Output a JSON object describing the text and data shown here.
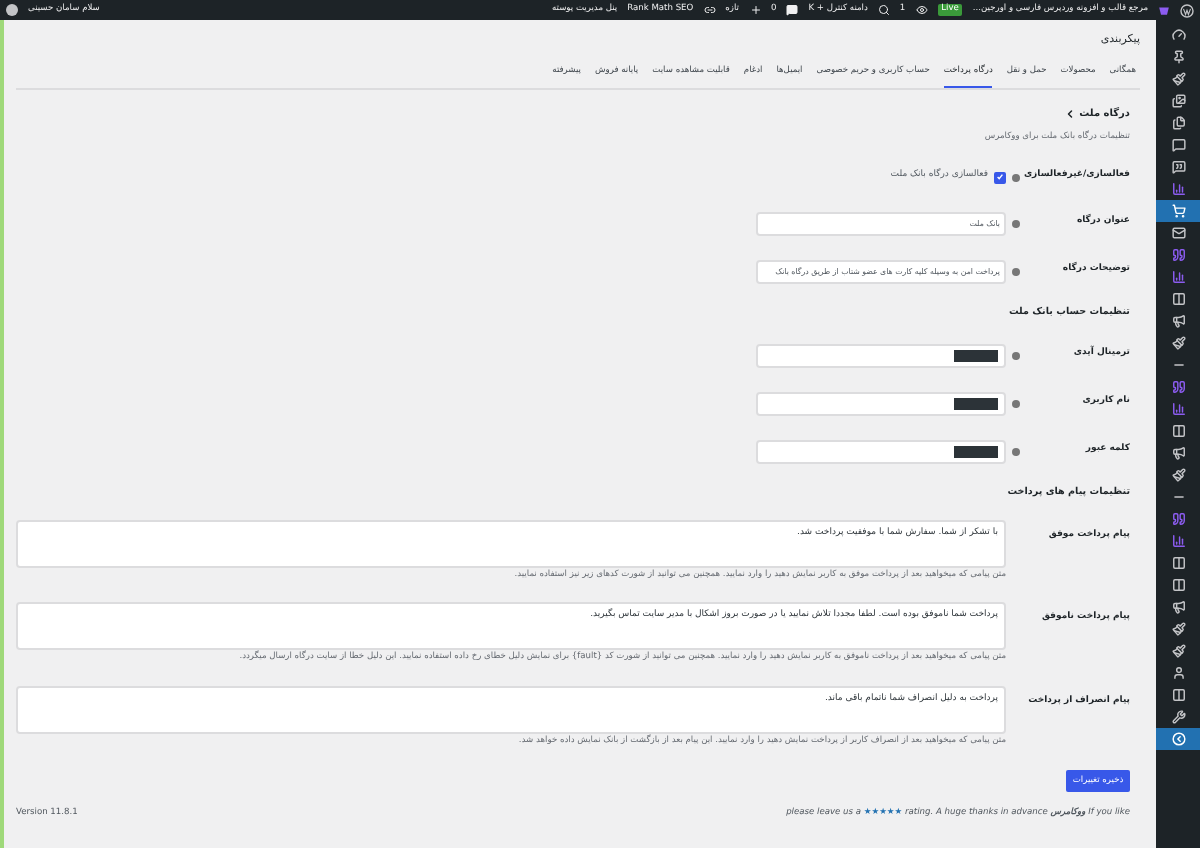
{
  "admin_bar": {
    "site_title": "مرجع قالب و افزونه وردپرس فارسی و اورجین...",
    "live_badge": "Live",
    "views": "1",
    "search": "دامنه کنترل + K",
    "comments": "0",
    "new": "تازه",
    "seo": "Rank Math SEO",
    "theme_panel": "پنل مدیریت پوسته",
    "greeting": "سلام سامان حسینی"
  },
  "sidebar": {
    "items": [
      {
        "kind": "dashboard",
        "selected": false
      },
      {
        "kind": "pin",
        "selected": false
      },
      {
        "kind": "brush",
        "selected": false
      },
      {
        "kind": "media",
        "selected": false
      },
      {
        "kind": "pages",
        "selected": false
      },
      {
        "kind": "comments",
        "selected": false
      },
      {
        "kind": "feedback",
        "selected": false
      },
      {
        "kind": "chart",
        "selected": false
      },
      {
        "kind": "store",
        "selected": true
      },
      {
        "kind": "mail",
        "selected": false
      },
      {
        "kind": "quote",
        "selected": false
      },
      {
        "kind": "chart",
        "selected": false
      },
      {
        "kind": "columns",
        "selected": false
      },
      {
        "kind": "megaphone",
        "selected": false
      },
      {
        "kind": "brush",
        "selected": false
      },
      {
        "kind": "separator",
        "selected": false
      },
      {
        "kind": "quote",
        "selected": false
      },
      {
        "kind": "chart",
        "selected": false
      },
      {
        "kind": "columns",
        "selected": false
      },
      {
        "kind": "megaphone",
        "selected": false
      },
      {
        "kind": "brush",
        "selected": false
      },
      {
        "kind": "separator",
        "selected": false
      },
      {
        "kind": "quote",
        "selected": false
      },
      {
        "kind": "chart",
        "selected": false
      },
      {
        "kind": "columns",
        "selected": false
      },
      {
        "kind": "columns",
        "selected": false
      },
      {
        "kind": "megaphone",
        "selected": false
      },
      {
        "kind": "brush",
        "selected": false
      },
      {
        "kind": "brush",
        "selected": false
      },
      {
        "kind": "user",
        "selected": false
      },
      {
        "kind": "columns",
        "selected": false
      },
      {
        "kind": "wrench",
        "selected": false
      },
      {
        "kind": "collapse",
        "selected": true
      }
    ]
  },
  "page_title": "پیکربندی",
  "tabs": [
    {
      "label": "همگانی",
      "selected": false
    },
    {
      "label": "محصولات",
      "selected": false
    },
    {
      "label": "حمل و نقل",
      "selected": false
    },
    {
      "label": "درگاه پرداخت",
      "selected": true
    },
    {
      "label": "حساب کاربری و حریم خصوصی",
      "selected": false
    },
    {
      "label": "ایمیل‌ها",
      "selected": false
    },
    {
      "label": "ادغام",
      "selected": false
    },
    {
      "label": "قابلیت مشاهده سایت",
      "selected": false
    },
    {
      "label": "پایانه فروش",
      "selected": false
    },
    {
      "label": "پیشرفته",
      "selected": false
    }
  ],
  "section": {
    "back": "درگاه ملت",
    "description": "تنظیمات درگاه بانک ملت برای ووکامرس"
  },
  "fields": [
    {
      "kind": "checkbox",
      "label": "فعالسازی/غیرفعالسازی",
      "text": "فعالسازی درگاه بانک ملت",
      "checked": true
    },
    {
      "kind": "text",
      "label": "عنوان درگاه",
      "value": "بانک ملت"
    },
    {
      "kind": "text",
      "label": "توضیحات درگاه",
      "value": "پرداخت امن به وسیله کلیه کارت های عضو شتاب از طریق درگاه بانک"
    },
    {
      "kind": "heading",
      "text": "تنظیمات حساب بانک ملت"
    },
    {
      "kind": "secret",
      "label": "ترمینال آیدی"
    },
    {
      "kind": "secret",
      "label": "نام کاربری"
    },
    {
      "kind": "secret",
      "label": "کلمه عبور"
    },
    {
      "kind": "heading",
      "text": "تنظیمات پیام های پرداخت"
    },
    {
      "kind": "textarea",
      "label": "پیام پرداخت موفق",
      "value": "با تشکر از شما. سفارش شما با موفقیت پرداخت شد.",
      "description": "متن پیامی که میخواهید بعد از پرداخت موفق به کاربر نمایش دهید را وارد نمایید. همچنین می توانید از شورت کدهای زیر نیز استفاده نمایید."
    },
    {
      "kind": "textarea",
      "label": "پیام پرداخت ناموفق",
      "value": "پرداخت شما ناموفق بوده است. لطفا مجددا تلاش نمایید یا در صورت بروز اشکال با مدیر سایت تماس بگیرید.",
      "description": "متن پیامی که میخواهید بعد از پرداخت ناموفق به کاربر نمایش دهید را وارد نمایید. همچنین می توانید از شورت کد {fault} برای نمایش دلیل خطای رخ داده استفاده نمایید. این دلیل خطا از سایت درگاه ارسال میگردد."
    },
    {
      "kind": "textarea",
      "label": "پیام انصراف از پرداخت",
      "value": "پرداخت به دلیل انصراف شما ناتمام باقی ماند.",
      "description": "متن پیامی که میخواهید بعد از انصراف کاربر از پرداخت نمایش دهید را وارد نمایید. این پیام بعد از بازگشت از بانک نمایش داده خواهد شد."
    }
  ],
  "save_button": "ذخیره تغییرات",
  "footer": {
    "before": "If you like ",
    "brand": "ووکامرس",
    "middle": " please leave us a ",
    "stars_link": "★★★★★",
    "after": " rating. A huge thanks in advance",
    "version": "Version 11.8.1"
  }
}
